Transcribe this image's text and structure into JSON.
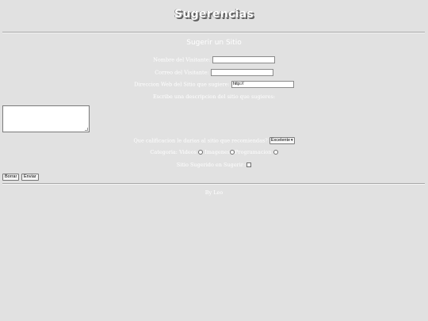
{
  "header": {
    "logo_text": "Sugerencias",
    "subtitle": "Sugerir un Sitio"
  },
  "form": {
    "visitor_name_label": "Nombre del Visitante:",
    "visitor_name_value": "",
    "visitor_email_label": "Correo del Visitante:",
    "visitor_email_value": "",
    "site_url_label": "Direccion Web del Sitio que sugiere:",
    "site_url_value": "http://",
    "description_label": "Escribe una descripcion del sitio que sugieres:",
    "description_value": "",
    "rating_label": "Que calificacion le darias al sitio que recomiendas?",
    "rating_selected": "Excelente",
    "category_label": "Categoria:",
    "category_options": [
      "Videos",
      "Imagenes",
      "Programacion"
    ],
    "already_suggested_label": "Sitio Sugerido en Sugerir:",
    "reset_label": "Borrar",
    "submit_label": "Enviar"
  },
  "footer": {
    "credit": "By Leo"
  },
  "colors": {
    "background": "#e1e1e1",
    "text": "#ffffff"
  }
}
